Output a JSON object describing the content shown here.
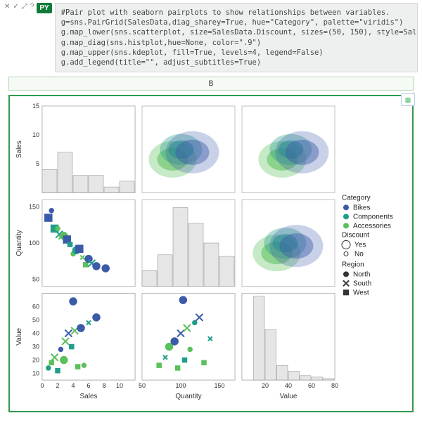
{
  "toolbar": {
    "close": "✕",
    "accept": "✓",
    "expand": "⤢",
    "help": "?"
  },
  "badge": {
    "label": "PY"
  },
  "code": "#Pair plot with seaborn pairplots to show relationships between variables.\ng=sns.PairGrid(SalesData,diag_sharey=True, hue=\"Category\", palette=\"viridis\")\ng.map_lower(sns.scatterplot, size=SalesData.Discount, sizes=(50, 150), style=SalesData.Region\ng.map_diag(sns.histplot,hue=None, color=\".9\")\ng.map_upper(sns.kdeplot, fill=True, levels=4, legend=False)\ng.add_legend(title=\"\", adjust_subtitles=True)",
  "column_header": "B",
  "chart_data": {
    "type": "pairgrid",
    "variables": [
      "Sales",
      "Quantity",
      "Value"
    ],
    "legend": {
      "category_title": "Category",
      "categories": [
        "Bikes",
        "Components",
        "Accessories"
      ],
      "category_colors": [
        "#3b5aa8",
        "#1f9e8a",
        "#5bc05b"
      ],
      "discount_title": "Discount",
      "discounts": [
        "Yes",
        "No"
      ],
      "region_title": "Region",
      "regions": [
        "North",
        "South",
        "West"
      ]
    },
    "diag_hist": {
      "sales": {
        "bins": [
          0,
          2,
          4,
          6,
          8,
          10,
          12
        ],
        "counts": [
          4,
          7,
          3,
          3,
          1,
          2
        ],
        "ylim": [
          0,
          15
        ],
        "yticks": [
          5,
          10,
          15
        ]
      },
      "quantity": {
        "bins": [
          50,
          70,
          90,
          110,
          130,
          150,
          170
        ],
        "counts": [
          20,
          40,
          100,
          80,
          55,
          38
        ],
        "ylim": [
          0,
          110
        ]
      },
      "value": {
        "bins": [
          0,
          10,
          20,
          30,
          40,
          50,
          60,
          70,
          80
        ],
        "counts": [
          0,
          58,
          35,
          10,
          6,
          3,
          2,
          1
        ],
        "ylim": [
          0,
          60
        ],
        "xticks": [
          20,
          40,
          60,
          80
        ]
      }
    },
    "lower_scatter": {
      "quantity_vs_sales": {
        "x_range": [
          0,
          12
        ],
        "y_range": [
          40,
          160
        ],
        "yticks": [
          50,
          100,
          150
        ],
        "points": [
          {
            "x": 0.8,
            "y": 135,
            "cat": 0,
            "reg": 2,
            "disc": 0
          },
          {
            "x": 1.2,
            "y": 145,
            "cat": 0,
            "reg": 0,
            "disc": 1
          },
          {
            "x": 1.6,
            "y": 120,
            "cat": 1,
            "reg": 2,
            "disc": 0
          },
          {
            "x": 2.0,
            "y": 120,
            "cat": 2,
            "reg": 0,
            "disc": 1
          },
          {
            "x": 2.2,
            "y": 112,
            "cat": 1,
            "reg": 1,
            "disc": 0
          },
          {
            "x": 2.4,
            "y": 108,
            "cat": 2,
            "reg": 1,
            "disc": 1
          },
          {
            "x": 2.8,
            "y": 110,
            "cat": 2,
            "reg": 0,
            "disc": 0
          },
          {
            "x": 3.0,
            "y": 102,
            "cat": 2,
            "reg": 1,
            "disc": 1
          },
          {
            "x": 3.2,
            "y": 105,
            "cat": 0,
            "reg": 2,
            "disc": 0
          },
          {
            "x": 3.6,
            "y": 98,
            "cat": 1,
            "reg": 2,
            "disc": 1
          },
          {
            "x": 4.0,
            "y": 85,
            "cat": 2,
            "reg": 0,
            "disc": 1
          },
          {
            "x": 4.4,
            "y": 90,
            "cat": 1,
            "reg": 0,
            "disc": 0
          },
          {
            "x": 4.8,
            "y": 92,
            "cat": 0,
            "reg": 2,
            "disc": 0
          },
          {
            "x": 5.2,
            "y": 80,
            "cat": 2,
            "reg": 1,
            "disc": 1
          },
          {
            "x": 5.6,
            "y": 70,
            "cat": 2,
            "reg": 2,
            "disc": 1
          },
          {
            "x": 6.0,
            "y": 78,
            "cat": 0,
            "reg": 0,
            "disc": 0
          },
          {
            "x": 6.4,
            "y": 72,
            "cat": 1,
            "reg": 1,
            "disc": 0
          },
          {
            "x": 7.0,
            "y": 68,
            "cat": 0,
            "reg": 0,
            "disc": 0
          },
          {
            "x": 8.2,
            "y": 65,
            "cat": 0,
            "reg": 0,
            "disc": 0
          }
        ]
      },
      "value_vs_sales": {
        "x_range": [
          0,
          12
        ],
        "y_range": [
          5,
          70
        ],
        "yticks": [
          10,
          20,
          30,
          40,
          50,
          60
        ],
        "points": [
          {
            "x": 0.8,
            "y": 14,
            "cat": 1,
            "reg": 0,
            "disc": 1
          },
          {
            "x": 1.2,
            "y": 18,
            "cat": 2,
            "reg": 2,
            "disc": 1
          },
          {
            "x": 1.6,
            "y": 22,
            "cat": 2,
            "reg": 1,
            "disc": 0
          },
          {
            "x": 2.0,
            "y": 12,
            "cat": 1,
            "reg": 2,
            "disc": 1
          },
          {
            "x": 2.4,
            "y": 28,
            "cat": 0,
            "reg": 0,
            "disc": 1
          },
          {
            "x": 2.8,
            "y": 20,
            "cat": 2,
            "reg": 0,
            "disc": 0
          },
          {
            "x": 3.0,
            "y": 34,
            "cat": 2,
            "reg": 1,
            "disc": 0
          },
          {
            "x": 3.4,
            "y": 40,
            "cat": 0,
            "reg": 1,
            "disc": 0
          },
          {
            "x": 3.8,
            "y": 30,
            "cat": 1,
            "reg": 2,
            "disc": 1
          },
          {
            "x": 4.2,
            "y": 42,
            "cat": 2,
            "reg": 1,
            "disc": 0
          },
          {
            "x": 4.6,
            "y": 15,
            "cat": 2,
            "reg": 2,
            "disc": 1
          },
          {
            "x": 5.0,
            "y": 44,
            "cat": 0,
            "reg": 0,
            "disc": 0
          },
          {
            "x": 5.4,
            "y": 16,
            "cat": 2,
            "reg": 0,
            "disc": 1
          },
          {
            "x": 4.0,
            "y": 64,
            "cat": 0,
            "reg": 0,
            "disc": 0
          },
          {
            "x": 6.0,
            "y": 48,
            "cat": 1,
            "reg": 1,
            "disc": 1
          },
          {
            "x": 7.0,
            "y": 52,
            "cat": 0,
            "reg": 0,
            "disc": 0
          }
        ]
      },
      "value_vs_quantity": {
        "x_range": [
          50,
          170
        ],
        "y_range": [
          5,
          70
        ],
        "xticks": [
          50,
          100,
          150
        ],
        "points": [
          {
            "x": 72,
            "y": 16,
            "cat": 2,
            "reg": 2,
            "disc": 1
          },
          {
            "x": 80,
            "y": 22,
            "cat": 1,
            "reg": 1,
            "disc": 1
          },
          {
            "x": 85,
            "y": 30,
            "cat": 2,
            "reg": 0,
            "disc": 0
          },
          {
            "x": 92,
            "y": 34,
            "cat": 0,
            "reg": 0,
            "disc": 0
          },
          {
            "x": 96,
            "y": 14,
            "cat": 2,
            "reg": 2,
            "disc": 1
          },
          {
            "x": 100,
            "y": 40,
            "cat": 0,
            "reg": 1,
            "disc": 0
          },
          {
            "x": 105,
            "y": 20,
            "cat": 1,
            "reg": 2,
            "disc": 1
          },
          {
            "x": 108,
            "y": 44,
            "cat": 2,
            "reg": 1,
            "disc": 0
          },
          {
            "x": 112,
            "y": 28,
            "cat": 2,
            "reg": 0,
            "disc": 1
          },
          {
            "x": 118,
            "y": 48,
            "cat": 1,
            "reg": 0,
            "disc": 1
          },
          {
            "x": 124,
            "y": 52,
            "cat": 0,
            "reg": 1,
            "disc": 0
          },
          {
            "x": 103,
            "y": 65,
            "cat": 0,
            "reg": 0,
            "disc": 0
          },
          {
            "x": 130,
            "y": 18,
            "cat": 2,
            "reg": 2,
            "disc": 1
          },
          {
            "x": 138,
            "y": 36,
            "cat": 1,
            "reg": 1,
            "disc": 1
          }
        ]
      }
    },
    "axes": {
      "sales_ticks": [
        0,
        2,
        4,
        6,
        8,
        10
      ],
      "quantity_ticks": [
        50,
        100,
        150
      ],
      "value_ticks": [
        20,
        40,
        60,
        80
      ]
    }
  }
}
